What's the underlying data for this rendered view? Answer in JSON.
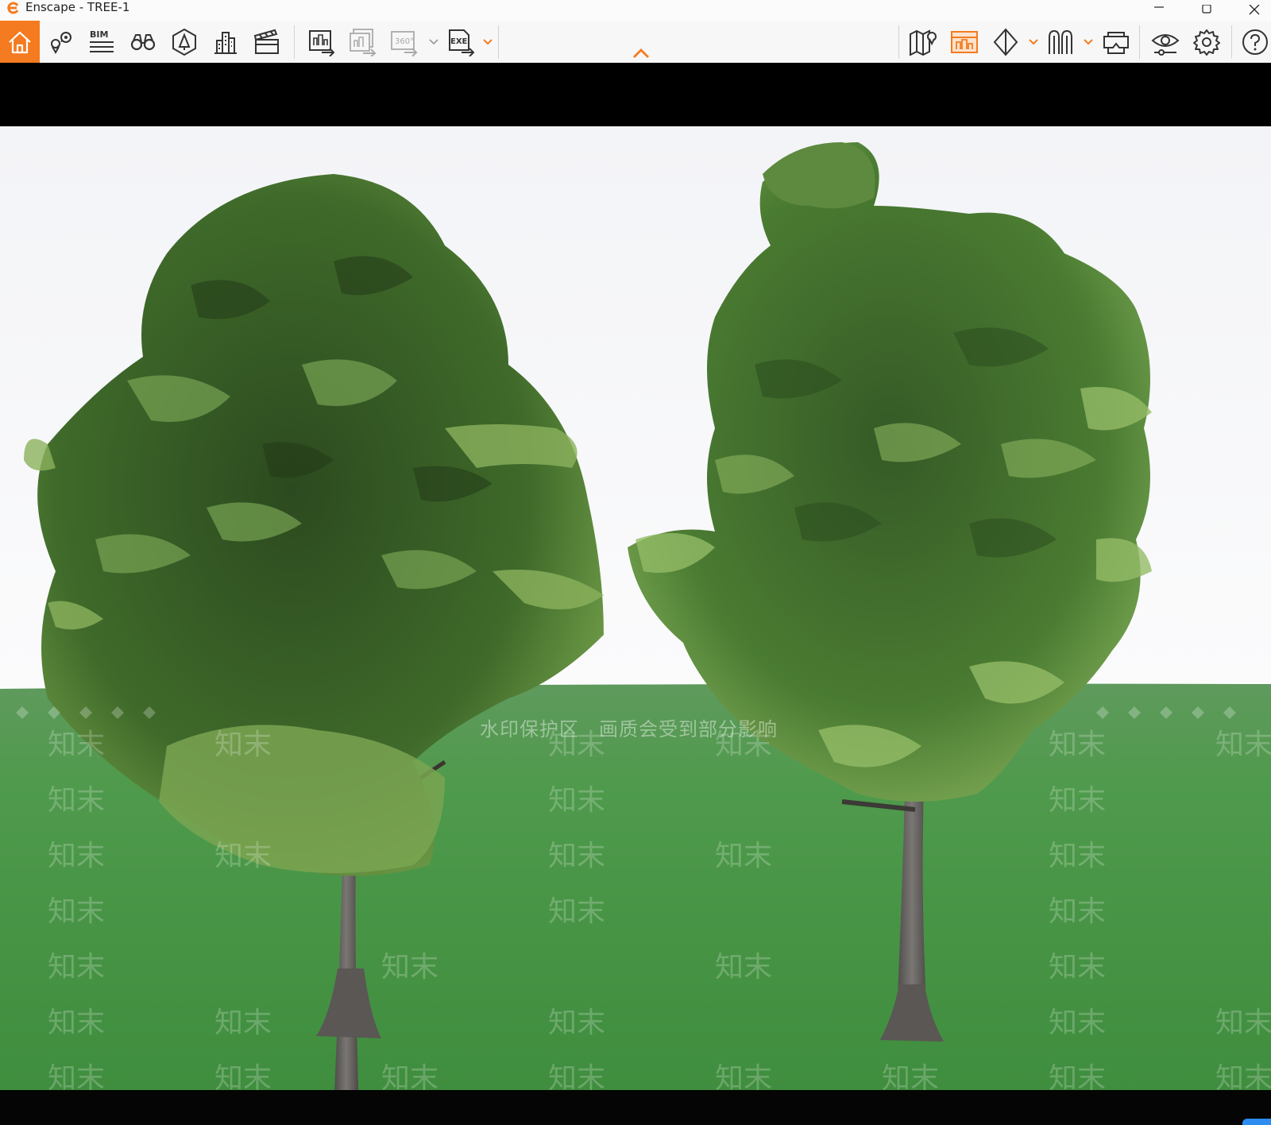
{
  "window": {
    "title": "Enscape - TREE-1",
    "controls": [
      "minimize-icon",
      "maximize-icon",
      "close-icon"
    ]
  },
  "toolbar": {
    "left_buttons": [
      {
        "icon": "home-icon",
        "active": true
      },
      {
        "icon": "location-pins-icon"
      },
      {
        "icon": "bim-info-icon",
        "label": "BIM"
      },
      {
        "icon": "binoculars-icon"
      },
      {
        "icon": "asset-library-icon"
      },
      {
        "icon": "buildings-icon"
      },
      {
        "icon": "clapperboard-icon"
      },
      {
        "icon": "render-screenshot-icon"
      },
      {
        "icon": "batch-render-icon"
      },
      {
        "icon": "panorama-icon",
        "label": "360°"
      },
      {
        "icon": "export-exe-icon",
        "label": "EXE"
      }
    ],
    "right_buttons": [
      {
        "icon": "map-pin-icon"
      },
      {
        "icon": "sketch-mode-icon",
        "active": true
      },
      {
        "icon": "view-mode-icon"
      },
      {
        "icon": "people-icon"
      },
      {
        "icon": "vr-headset-icon"
      },
      {
        "icon": "eye-settings-icon"
      },
      {
        "icon": "gear-icon"
      },
      {
        "icon": "help-icon"
      }
    ],
    "accent_color": "#f47b20"
  },
  "watermark": {
    "logo_text": "知末",
    "notice": "水印保护区　画质会受到部分影响"
  }
}
